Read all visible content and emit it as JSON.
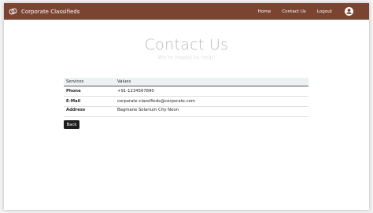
{
  "navbar": {
    "brand": "Corporate Classifieds",
    "links": [
      "Home",
      "Contact Us",
      "Logout"
    ]
  },
  "icons": {
    "logo": "rings-logo-icon",
    "avatar": "user-avatar-icon"
  },
  "colors": {
    "navbar": "#7a4430",
    "button": "#1e1e1e",
    "title": "#b8b8b8"
  },
  "page": {
    "title": "Contact Us",
    "subtitle": "We're happy to help!"
  },
  "table": {
    "headers": [
      "Services",
      "Values"
    ],
    "rows": [
      {
        "service": "Phone",
        "value": "+91-1234567890"
      },
      {
        "service": "E-Mail",
        "value": "corporate-classifieds@corporate.com"
      },
      {
        "service": "Address",
        "value": "Bagmane Solarium City Neon"
      }
    ]
  },
  "back_button": "Back"
}
